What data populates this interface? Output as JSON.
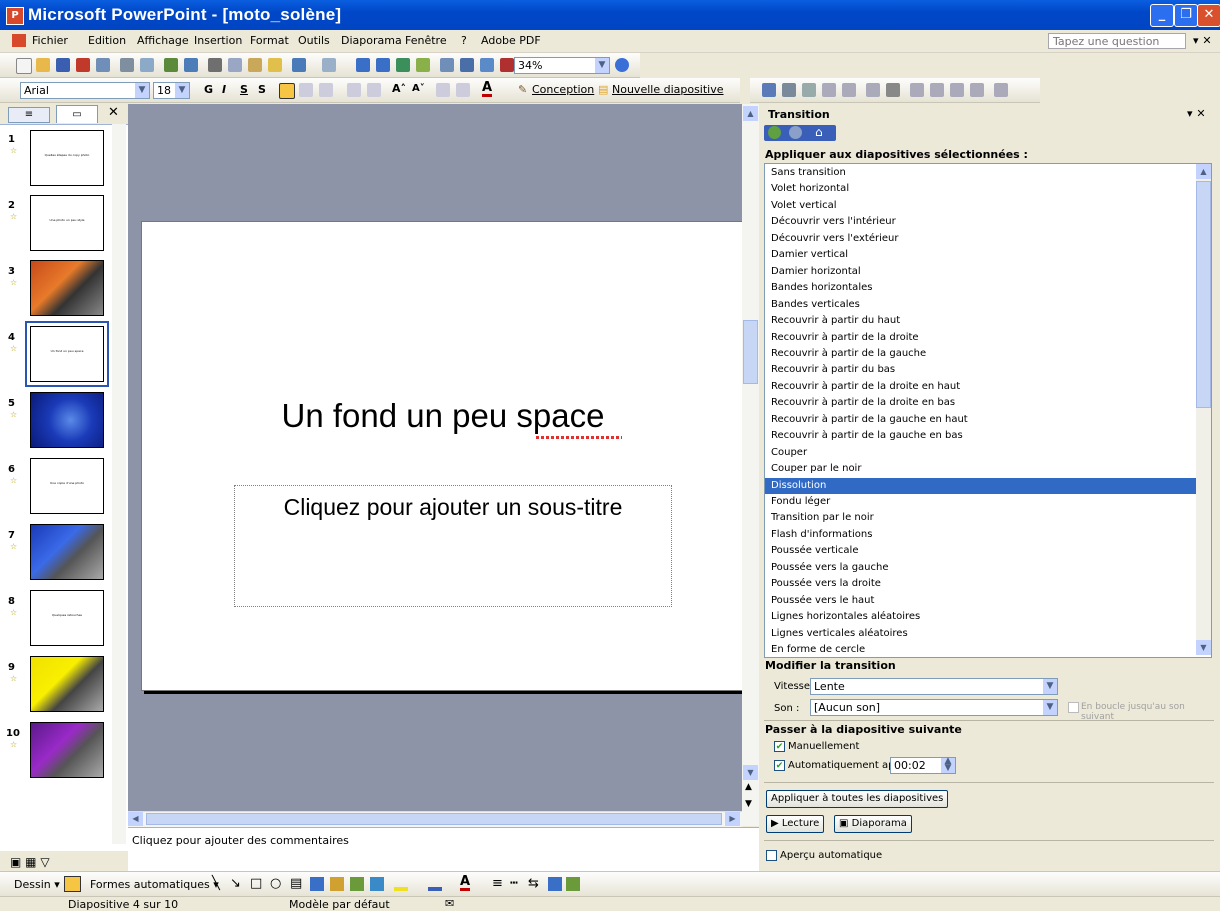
{
  "window": {
    "title": "Microsoft PowerPoint - [moto_solène]"
  },
  "menu": {
    "items": [
      "Fichier",
      "Edition",
      "Affichage",
      "Insertion",
      "Format",
      "Outils",
      "Diaporama",
      "Fenêtre",
      "?",
      "Adobe PDF"
    ],
    "ask_placeholder": "Tapez une question"
  },
  "toolbar": {
    "zoom": "34%",
    "font": "Arial",
    "size": "18",
    "design_label": "Conception",
    "new_slide_label": "Nouvelle diapositive"
  },
  "thumbnails": [
    {
      "num": "1",
      "text": "Quelles étapes du copy photo"
    },
    {
      "num": "2",
      "text": "Une photo un peu style"
    },
    {
      "num": "3",
      "text": ""
    },
    {
      "num": "4",
      "text": "Un fond un peu space"
    },
    {
      "num": "5",
      "text": ""
    },
    {
      "num": "6",
      "text": "Une copie d'une photo"
    },
    {
      "num": "7",
      "text": ""
    },
    {
      "num": "8",
      "text": "Quelques retouches"
    },
    {
      "num": "9",
      "text": ""
    },
    {
      "num": "10",
      "text": ""
    }
  ],
  "slide": {
    "title": "Un fond un peu space",
    "subtitle_placeholder": "Cliquez pour ajouter un sous-titre"
  },
  "notes_placeholder": "Cliquez pour ajouter des commentaires",
  "taskpane": {
    "title": "Transition",
    "apply_label": "Appliquer aux diapositives sélectionnées :",
    "transitions": [
      "Sans transition",
      "Volet horizontal",
      "Volet vertical",
      "Découvrir vers l'intérieur",
      "Découvrir vers l'extérieur",
      "Damier vertical",
      "Damier horizontal",
      "Bandes horizontales",
      "Bandes verticales",
      "Recouvrir à partir du haut",
      "Recouvrir à partir de la droite",
      "Recouvrir à partir de la gauche",
      "Recouvrir à partir du bas",
      "Recouvrir à partir de la droite en haut",
      "Recouvrir à partir de la droite en bas",
      "Recouvrir à partir de la gauche en  haut",
      "Recouvrir à partir de la gauche en  bas",
      "Couper",
      "Couper par le noir",
      "Dissolution",
      "Fondu léger",
      "Transition par le noir",
      "Flash d'informations",
      "Poussée verticale",
      "Poussée vers la gauche",
      "Poussée vers la droite",
      "Poussée vers le haut",
      "Lignes horizontales aléatoires",
      "Lignes verticales aléatoires",
      "En forme de cercle"
    ],
    "selected_index": 19,
    "modify_heading": "Modifier la transition",
    "speed_label": "Vitesse :",
    "speed_value": "Lente",
    "sound_label": "Son :",
    "sound_value": "[Aucun son]",
    "loop_label": "En boucle jusqu'au son suivant",
    "advance_heading": "Passer à la diapositive suivante",
    "manual_label": "Manuellement",
    "auto_label": "Automatiquement après",
    "auto_time": "00:02",
    "apply_all_button": "Appliquer à toutes les diapositives",
    "play_button": "Lecture",
    "slideshow_button": "Diaporama",
    "autopreview_label": "Aperçu automatique"
  },
  "drawbar": {
    "draw_label": "Dessin",
    "autoshapes_label": "Formes automatiques"
  },
  "status": {
    "slide": "Diapositive 4 sur 10",
    "template": "Modèle par défaut"
  },
  "colors": {
    "title_bar": "#0046c3",
    "selection": "#316ac5"
  }
}
